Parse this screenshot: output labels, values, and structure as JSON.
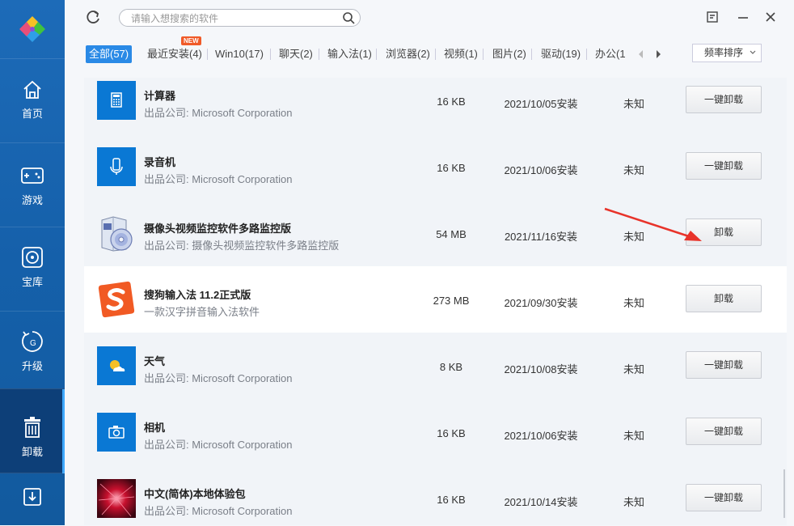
{
  "app_logo_icon": "pinwheel-logo",
  "sidebar": {
    "items": [
      {
        "label": "首页",
        "icon": "home-icon"
      },
      {
        "label": "游戏",
        "icon": "gamepad-icon"
      },
      {
        "label": "宝库",
        "icon": "disc-icon"
      },
      {
        "label": "升级",
        "icon": "upgrade-icon"
      },
      {
        "label": "卸载",
        "icon": "trash-icon",
        "active": true
      },
      {
        "label": "",
        "icon": "download-icon"
      }
    ]
  },
  "search": {
    "placeholder": "请输入想搜索的软件"
  },
  "tabs": [
    {
      "label": "全部(57)",
      "active": true
    },
    {
      "label": "最近安装(4)",
      "badge": "NEW"
    },
    {
      "label": "Win10(17)"
    },
    {
      "label": "聊天(2)"
    },
    {
      "label": "输入法(1)"
    },
    {
      "label": "浏览器(2)"
    },
    {
      "label": "视频(1)"
    },
    {
      "label": "图片(2)"
    },
    {
      "label": "驱动(19)"
    },
    {
      "label": "办公(1"
    }
  ],
  "sort": {
    "label": "频率排序"
  },
  "colors": {
    "accent": "#2a8ae6",
    "sidebar": "#1560aa",
    "sidebar_active": "#0d3f78",
    "arrow": "#e8332a"
  },
  "apps": [
    {
      "name": "计算器",
      "publisher": "出品公司: Microsoft Corporation",
      "size": "16 KB",
      "date": "2021/10/05安装",
      "rating": "未知",
      "button": "一键卸载",
      "icon": "calculator-icon"
    },
    {
      "name": "录音机",
      "publisher": "出品公司: Microsoft Corporation",
      "size": "16 KB",
      "date": "2021/10/06安装",
      "rating": "未知",
      "button": "一键卸载",
      "icon": "recorder-icon"
    },
    {
      "name": "摄像头视频监控软件多路监控版",
      "publisher": "出品公司: 摄像头视频监控软件多路监控版",
      "size": "54 MB",
      "date": "2021/11/16安装",
      "rating": "未知",
      "button": "卸载",
      "icon": "software-box-icon"
    },
    {
      "name": "搜狗输入法 11.2正式版",
      "publisher": "一款汉字拼音输入法软件",
      "size": "273 MB",
      "date": "2021/09/30安装",
      "rating": "未知",
      "button": "卸载",
      "icon": "sogou-icon"
    },
    {
      "name": "天气",
      "publisher": "出品公司: Microsoft Corporation",
      "size": "8 KB",
      "date": "2021/10/08安装",
      "rating": "未知",
      "button": "一键卸载",
      "icon": "weather-icon"
    },
    {
      "name": "相机",
      "publisher": "出品公司: Microsoft Corporation",
      "size": "16 KB",
      "date": "2021/10/06安装",
      "rating": "未知",
      "button": "一键卸载",
      "icon": "camera-icon"
    },
    {
      "name": "中文(简体)本地体验包",
      "publisher": "出品公司: Microsoft Corporation",
      "size": "16 KB",
      "date": "2021/10/14安装",
      "rating": "未知",
      "button": "一键卸载",
      "icon": "language-pack-icon"
    }
  ]
}
